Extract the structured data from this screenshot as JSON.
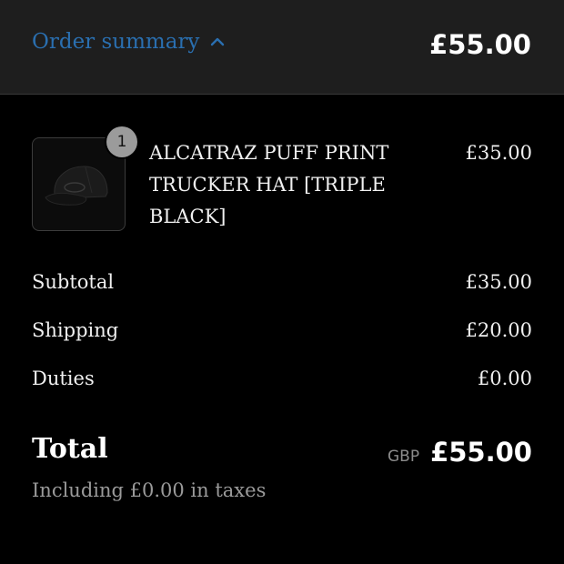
{
  "header": {
    "toggle_label": "Order summary",
    "total": "£55.00"
  },
  "item": {
    "quantity": "1",
    "name": "ALCATRAZ PUFF PRINT TRUCKER HAT [TRIPLE BLACK]",
    "price": "£35.00",
    "image_icon": "trucker-hat-icon"
  },
  "summary": {
    "subtotal_label": "Subtotal",
    "subtotal_value": "£35.00",
    "shipping_label": "Shipping",
    "shipping_value": "£20.00",
    "duties_label": "Duties",
    "duties_value": "£0.00"
  },
  "total": {
    "label": "Total",
    "currency": "GBP",
    "value": "£55.00",
    "tax_note": "Including £0.00 in taxes"
  },
  "colors": {
    "accent": "#2a6fb0",
    "background": "#000000",
    "header_background": "#1e1e1e"
  }
}
